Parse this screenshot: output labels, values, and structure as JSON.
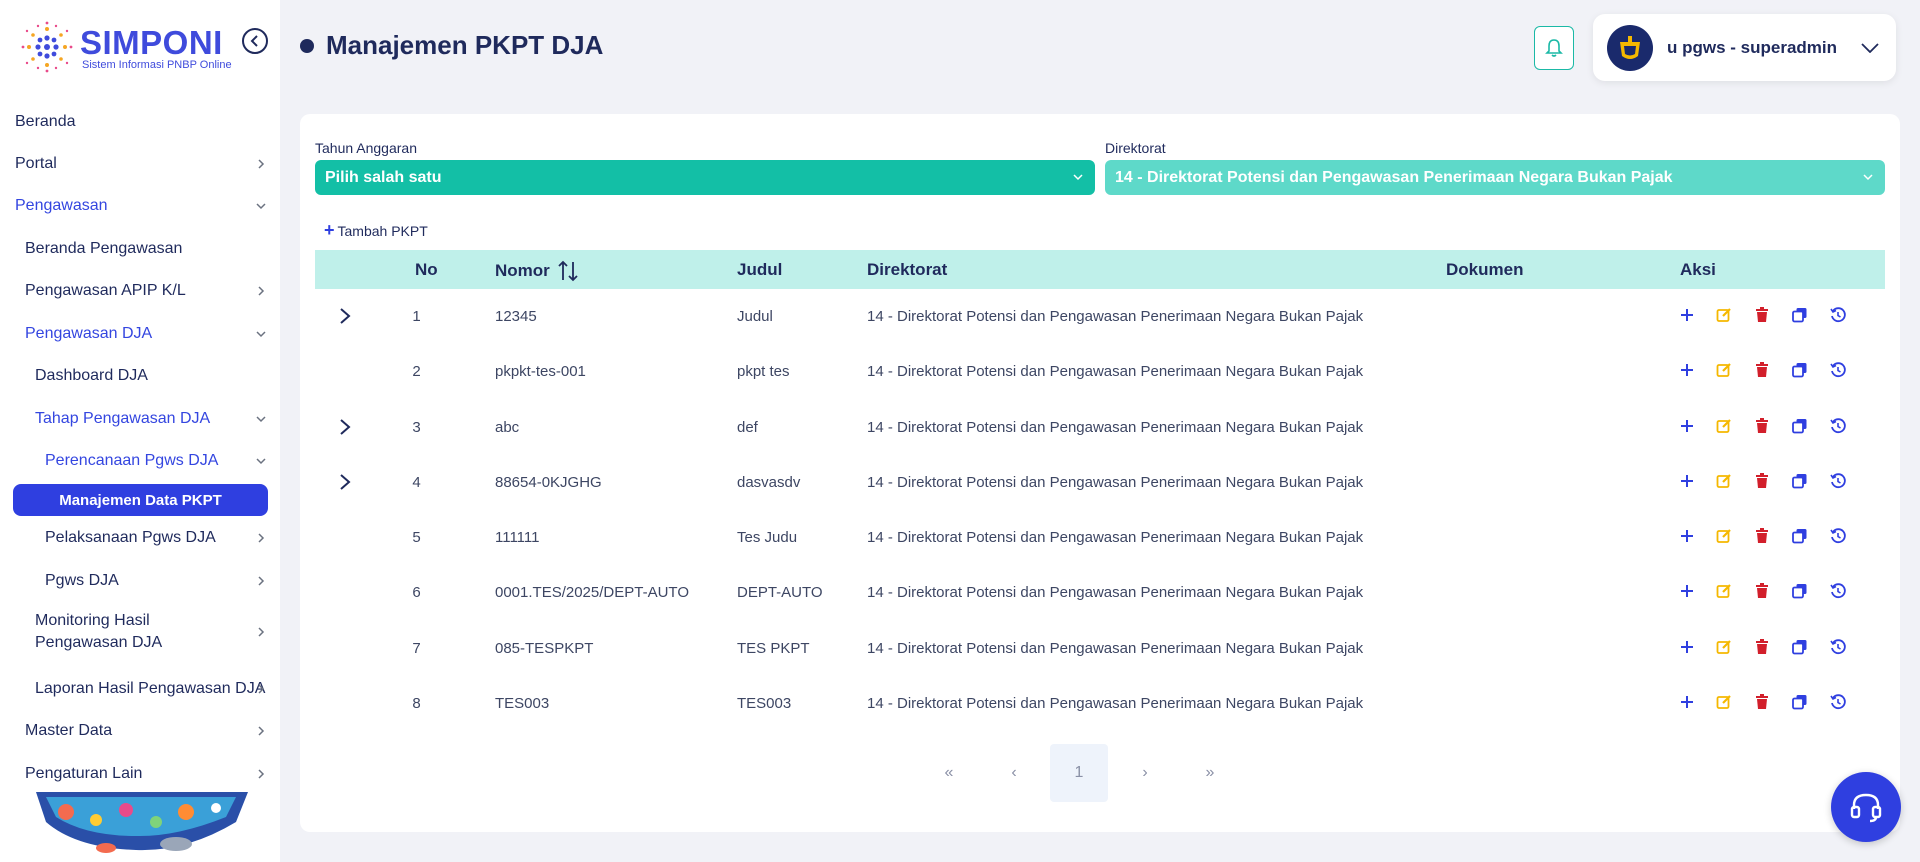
{
  "app": {
    "logo_title": "SIMPONI",
    "logo_subtitle": "Sistem Informasi PNBP Online"
  },
  "sidebar": {
    "items": [
      {
        "label": "Beranda"
      },
      {
        "label": "Portal"
      },
      {
        "label": "Pengawasan"
      },
      {
        "label": "Beranda Pengawasan"
      },
      {
        "label": "Pengawasan APIP K/L"
      },
      {
        "label": "Pengawasan DJA"
      },
      {
        "label": "Dashboard DJA"
      },
      {
        "label": "Tahap Pengawasan DJA"
      },
      {
        "label": "Perencanaan Pgws DJA"
      },
      {
        "label": "Manajemen Data PKPT"
      },
      {
        "label": "Pelaksanaan Pgws DJA"
      },
      {
        "label": "Pgws DJA"
      },
      {
        "label": "Monitoring Hasil Pengawasan DJA"
      },
      {
        "label": "Laporan Hasil Pengawasan DJA"
      },
      {
        "label": "Master Data"
      },
      {
        "label": "Pengaturan Lain"
      }
    ]
  },
  "header": {
    "title": "Manajemen PKPT DJA",
    "user_name": "u pgws - superadmin"
  },
  "filters": {
    "tahun_label": "Tahun Anggaran",
    "tahun_value": "Pilih salah satu",
    "direktorat_label": "Direktorat",
    "direktorat_value": "14 - Direktorat Potensi dan Pengawasan Penerimaan Negara Bukan Pajak"
  },
  "toolbar": {
    "add_label": "Tambah PKPT"
  },
  "table": {
    "columns": {
      "no": "No",
      "nomor": "Nomor",
      "judul": "Judul",
      "direktorat": "Direktorat",
      "dokumen": "Dokumen",
      "aksi": "Aksi"
    },
    "rows": [
      {
        "no": "1",
        "nomor": "12345",
        "judul": "Judul",
        "direktorat": "14 - Direktorat Potensi dan Pengawasan Penerimaan Negara Bukan Pajak",
        "expandable": true
      },
      {
        "no": "2",
        "nomor": "pkpkt-tes-001",
        "judul": "pkpt tes",
        "direktorat": "14 - Direktorat Potensi dan Pengawasan Penerimaan Negara Bukan Pajak",
        "expandable": false
      },
      {
        "no": "3",
        "nomor": "abc",
        "judul": "def",
        "direktorat": "14 - Direktorat Potensi dan Pengawasan Penerimaan Negara Bukan Pajak",
        "expandable": true
      },
      {
        "no": "4",
        "nomor": "88654-0KJGHG",
        "judul": "dasvasdv",
        "direktorat": "14 - Direktorat Potensi dan Pengawasan Penerimaan Negara Bukan Pajak",
        "expandable": true
      },
      {
        "no": "5",
        "nomor": "111111",
        "judul": "Tes Judu",
        "direktorat": "14 - Direktorat Potensi dan Pengawasan Penerimaan Negara Bukan Pajak",
        "expandable": false
      },
      {
        "no": "6",
        "nomor": "0001.TES/2025/DEPT-AUTO",
        "judul": "DEPT-AUTO",
        "direktorat": "14 - Direktorat Potensi dan Pengawasan Penerimaan Negara Bukan Pajak",
        "expandable": false
      },
      {
        "no": "7",
        "nomor": "085-TESPKPT",
        "judul": "TES PKPT",
        "direktorat": "14 - Direktorat Potensi dan Pengawasan Penerimaan Negara Bukan Pajak",
        "expandable": false
      },
      {
        "no": "8",
        "nomor": "TES003",
        "judul": "TES003",
        "direktorat": "14 - Direktorat Potensi dan Pengawasan Penerimaan Negara Bukan Pajak",
        "expandable": false
      }
    ]
  },
  "pagination": {
    "first": "«",
    "prev": "‹",
    "current": "1",
    "next": "›",
    "last": "»"
  },
  "colors": {
    "primary": "#2f3fe0",
    "teal": "#13bfa6",
    "teal_light": "#5ed9c9",
    "header_row": "#bff0ea",
    "edit": "#f5b800",
    "delete": "#d21f2b"
  },
  "icons": [
    "collapse-icon",
    "chevron-right-icon",
    "chevron-down-icon",
    "bell-icon",
    "plus-icon",
    "sort-icon",
    "edit-icon",
    "trash-icon",
    "copy-icon",
    "history-icon",
    "headset-icon"
  ]
}
